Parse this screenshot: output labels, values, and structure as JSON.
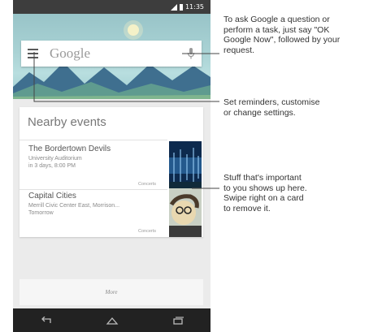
{
  "status_bar": {
    "time": "11:35",
    "icons": [
      "signal-icon",
      "battery-icon"
    ]
  },
  "search": {
    "logo_text": "Google",
    "icons": [
      "menu-icon",
      "mic-icon"
    ]
  },
  "card": {
    "title": "Nearby events",
    "events": [
      {
        "name": "The Bordertown Devils",
        "venue": "University Auditorium",
        "time": "in 3 days, 8:00 PM",
        "category": "Concerts"
      },
      {
        "name": "Capital Cities",
        "venue": "Merrill Civic Center East, Morrison...",
        "time": "Tomorrow",
        "category": "Concerts"
      }
    ]
  },
  "more": {
    "label": "More"
  },
  "nav": {
    "icons": [
      "back-icon",
      "home-icon",
      "recents-icon"
    ]
  },
  "callouts": {
    "ok_google": [
      "To ask Google a question or",
      "perform a task, just say \"OK",
      "Google Now\", followed by your",
      "request."
    ],
    "settings": [
      "Set reminders, customise",
      "or change settings."
    ],
    "cards": [
      "Stuff that's important",
      "to you shows up here.",
      "Swipe right on a card",
      "to remove it."
    ]
  },
  "colors": {
    "status_bar": "#3d3d3d",
    "nav_bar": "#222222",
    "header_sky": "#a9d2d4",
    "feed_bg": "#ebebeb",
    "mountains": "#3f6f8f"
  }
}
